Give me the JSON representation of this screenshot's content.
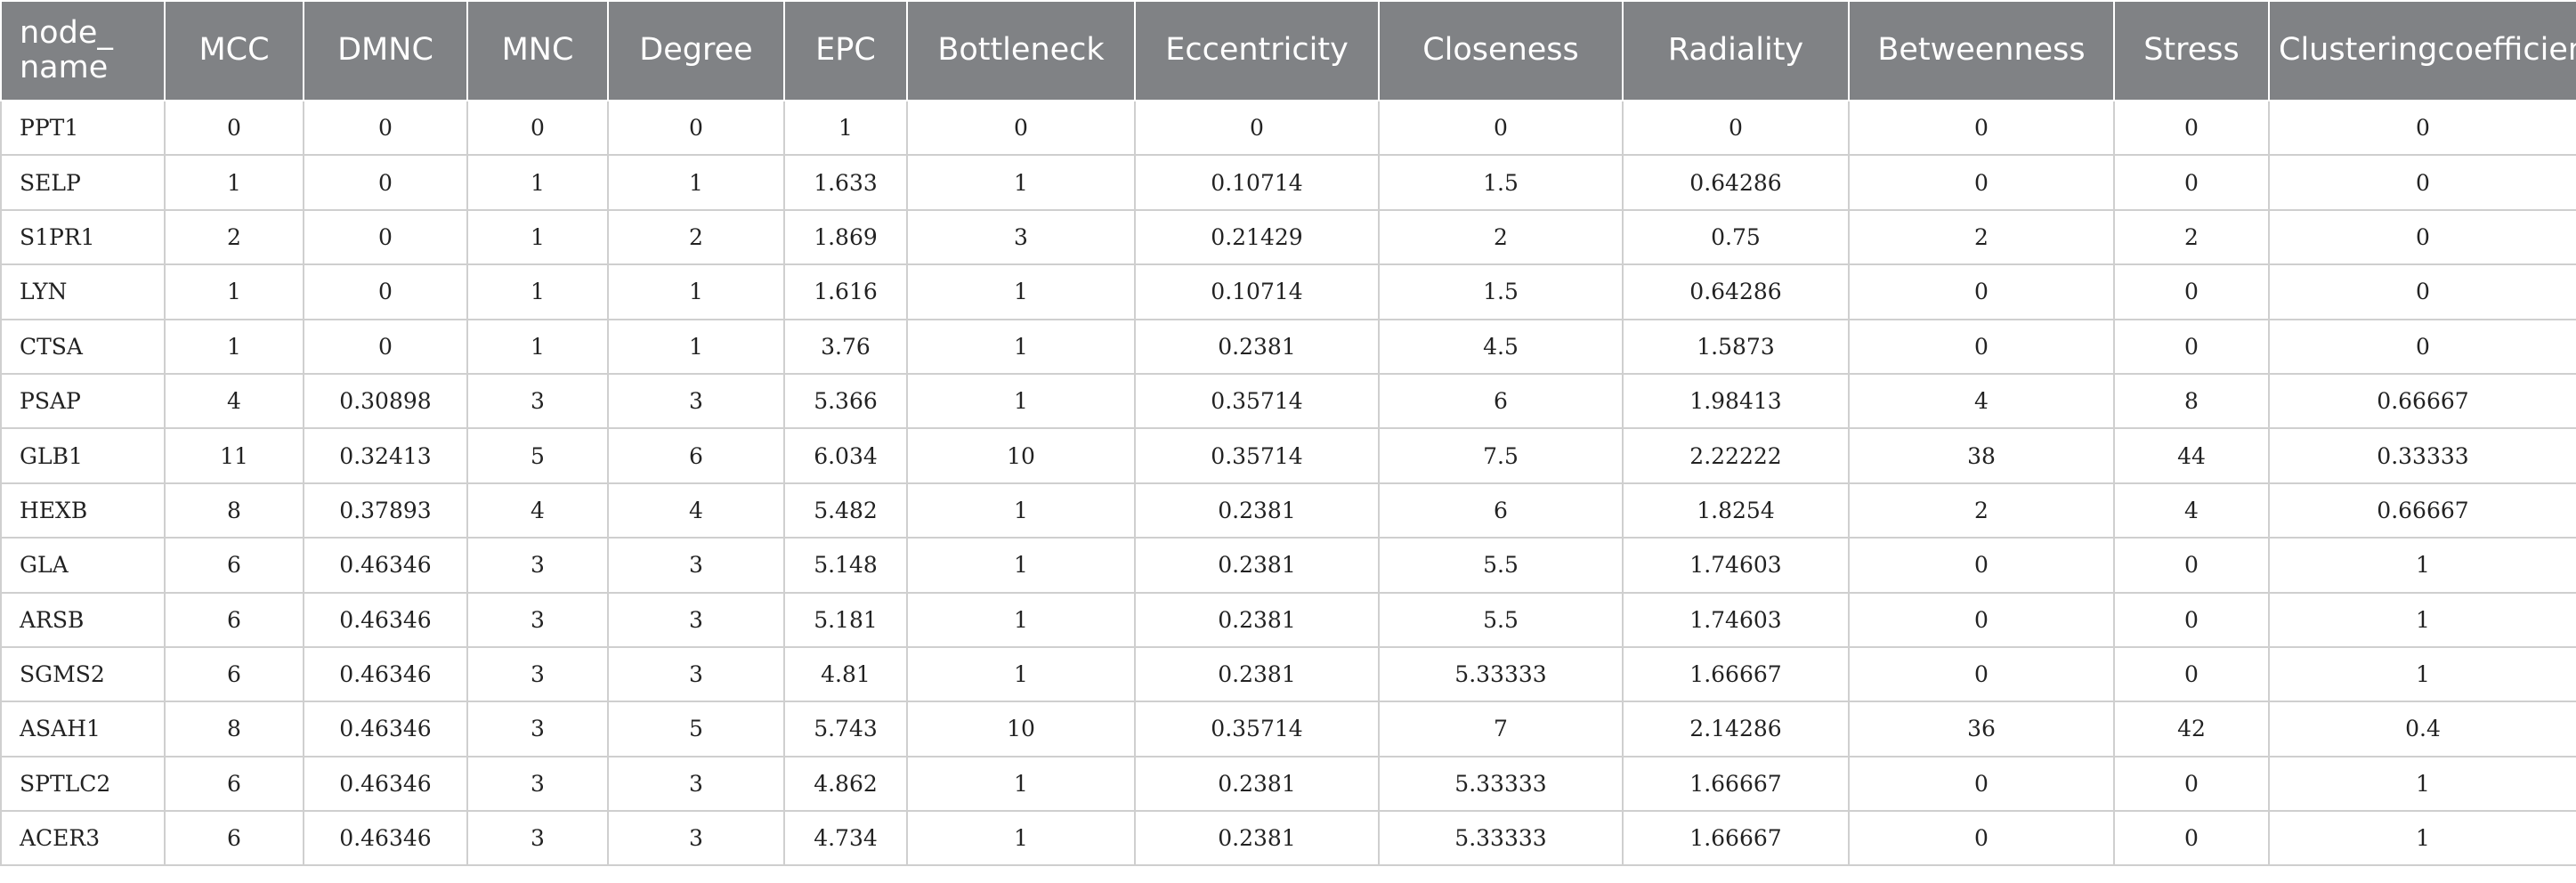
{
  "table": {
    "columns": [
      "node_ name",
      "MCC",
      "DMNC",
      "MNC",
      "Degree",
      "EPC",
      "Bottleneck",
      "Eccentricity",
      "Closeness",
      "Radiality",
      "Betweenness",
      "Stress",
      "Clusteringcoefficient"
    ],
    "rows": [
      [
        "PPT1",
        "0",
        "0",
        "0",
        "0",
        "1",
        "0",
        "0",
        "0",
        "0",
        "0",
        "0",
        "0"
      ],
      [
        "SELP",
        "1",
        "0",
        "1",
        "1",
        "1.633",
        "1",
        "0.10714",
        "1.5",
        "0.64286",
        "0",
        "0",
        "0"
      ],
      [
        "S1PR1",
        "2",
        "0",
        "1",
        "2",
        "1.869",
        "3",
        "0.21429",
        "2",
        "0.75",
        "2",
        "2",
        "0"
      ],
      [
        "LYN",
        "1",
        "0",
        "1",
        "1",
        "1.616",
        "1",
        "0.10714",
        "1.5",
        "0.64286",
        "0",
        "0",
        "0"
      ],
      [
        "CTSA",
        "1",
        "0",
        "1",
        "1",
        "3.76",
        "1",
        "0.2381",
        "4.5",
        "1.5873",
        "0",
        "0",
        "0"
      ],
      [
        "PSAP",
        "4",
        "0.30898",
        "3",
        "3",
        "5.366",
        "1",
        "0.35714",
        "6",
        "1.98413",
        "4",
        "8",
        "0.66667"
      ],
      [
        "GLB1",
        "11",
        "0.32413",
        "5",
        "6",
        "6.034",
        "10",
        "0.35714",
        "7.5",
        "2.22222",
        "38",
        "44",
        "0.33333"
      ],
      [
        "HEXB",
        "8",
        "0.37893",
        "4",
        "4",
        "5.482",
        "1",
        "0.2381",
        "6",
        "1.8254",
        "2",
        "4",
        "0.66667"
      ],
      [
        "GLA",
        "6",
        "0.46346",
        "3",
        "3",
        "5.148",
        "1",
        "0.2381",
        "5.5",
        "1.74603",
        "0",
        "0",
        "1"
      ],
      [
        "ARSB",
        "6",
        "0.46346",
        "3",
        "3",
        "5.181",
        "1",
        "0.2381",
        "5.5",
        "1.74603",
        "0",
        "0",
        "1"
      ],
      [
        "SGMS2",
        "6",
        "0.46346",
        "3",
        "3",
        "4.81",
        "1",
        "0.2381",
        "5.33333",
        "1.66667",
        "0",
        "0",
        "1"
      ],
      [
        "ASAH1",
        "8",
        "0.46346",
        "3",
        "5",
        "5.743",
        "10",
        "0.35714",
        "7",
        "2.14286",
        "36",
        "42",
        "0.4"
      ],
      [
        "SPTLC2",
        "6",
        "0.46346",
        "3",
        "3",
        "4.862",
        "1",
        "0.2381",
        "5.33333",
        "1.66667",
        "0",
        "0",
        "1"
      ],
      [
        "ACER3",
        "6",
        "0.46346",
        "3",
        "3",
        "4.734",
        "1",
        "0.2381",
        "5.33333",
        "1.66667",
        "0",
        "0",
        "1"
      ]
    ]
  },
  "colors": {
    "header_background": "#808285",
    "header_text": "#ffffff",
    "grid_line": "#cfcfcf"
  }
}
